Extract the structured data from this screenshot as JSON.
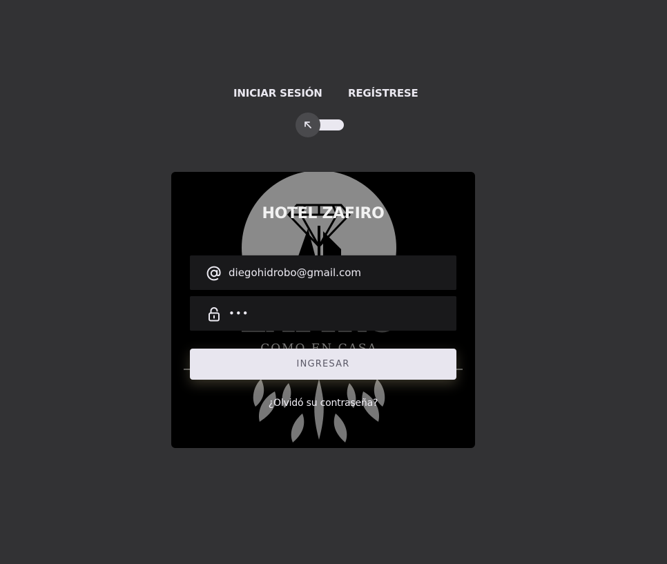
{
  "toggle": {
    "login_label": "INICIAR SESIÓN",
    "register_label": "REGÍSTRESE"
  },
  "card": {
    "title": "HOTEL ZAFIRO",
    "email": {
      "value": "diegohidrobo@gmail.com",
      "icon": "at-icon"
    },
    "password": {
      "value": "•••",
      "icon": "lock-icon"
    },
    "submit_label": "INGRESAR",
    "forgot_label": "¿Olvidó su contraseña?",
    "logo": {
      "big_text": "ZAFIRO",
      "tagline": "COMO EN CASA"
    }
  },
  "colors": {
    "background": "#323234",
    "card": "#000000",
    "field": "#19191b",
    "text": "#eae8f0",
    "button": "#e8e6ef"
  }
}
